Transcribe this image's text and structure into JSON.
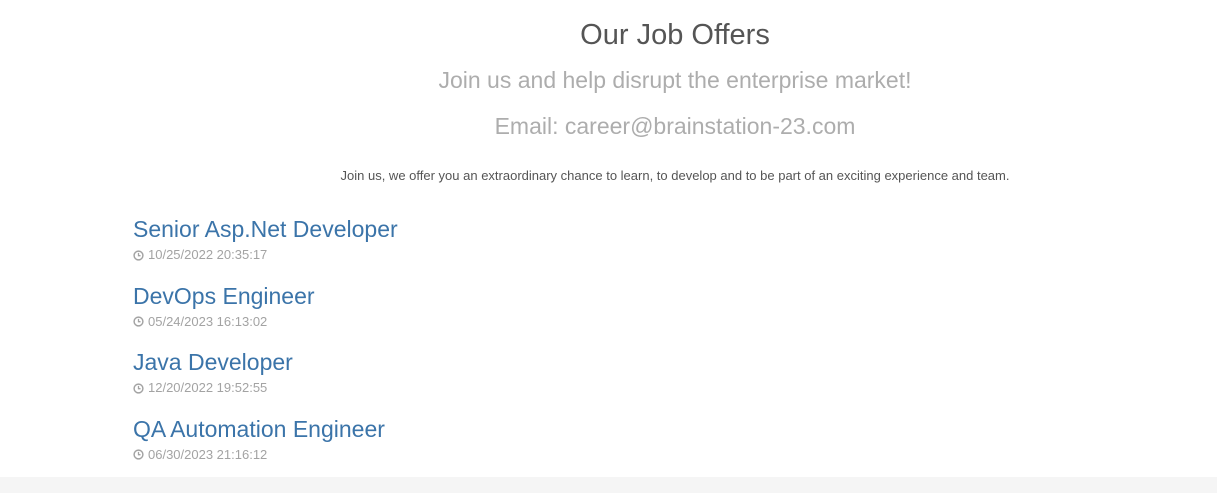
{
  "header": {
    "title": "Our Job Offers",
    "tagline": "Join us and help disrupt the enterprise market!",
    "email": "Email: career@brainstation-23.com",
    "intro": "Join us, we offer you an extraordinary chance to learn, to develop and to be part of an exciting experience and team."
  },
  "jobs": [
    {
      "title": "Senior Asp.Net Developer",
      "posted": "10/25/2022 20:35:17"
    },
    {
      "title": "DevOps Engineer",
      "posted": "05/24/2023 16:13:02"
    },
    {
      "title": "Java Developer",
      "posted": "12/20/2022 19:52:55"
    },
    {
      "title": "QA Automation Engineer",
      "posted": "06/30/2023 21:16:12"
    }
  ],
  "icons": {
    "date": "clock-icon"
  },
  "colors": {
    "link": "#3b74a9",
    "muted": "#adadad",
    "text": "#555555",
    "footer": "#f5f5f5"
  }
}
